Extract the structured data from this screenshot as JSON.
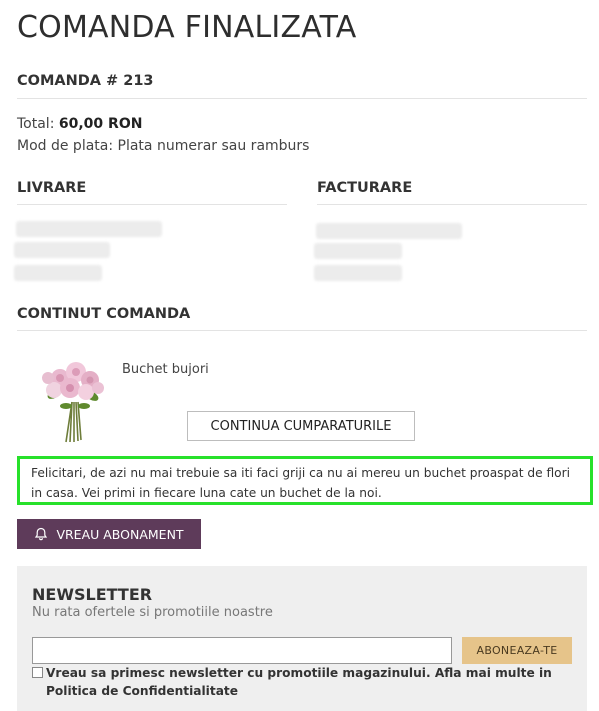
{
  "page_title": "COMANDA FINALIZATA",
  "order": {
    "heading": "COMANDA # 213",
    "total_label": "Total:",
    "total_value": "60,00 RON",
    "payment_line": "Mod de plata: Plata numerar sau ramburs"
  },
  "delivery": {
    "heading": "LIVRARE"
  },
  "billing": {
    "heading": "FACTURARE"
  },
  "contents": {
    "heading": "CONTINUT COMANDA",
    "product_name": "Buchet bujori",
    "continue_button": "CONTINUA CUMPARATURILE"
  },
  "notice": {
    "text": "Felicitari, de azi nu mai trebuie sa iti faci griji ca nu ai mereu un buchet proaspat de flori in casa. Vei primi in fiecare luna cate un buchet de la noi."
  },
  "subscription_button": "VREAU ABONAMENT",
  "newsletter": {
    "title": "NEWSLETTER",
    "subtitle": "Nu rata ofertele si promotiile noastre",
    "button": "ABONEAZA-TE",
    "consent_text": "Vreau sa primesc newsletter cu promotiile magazinului. Afla mai multe in ",
    "consent_link": "Politica de Confidentialitate"
  },
  "colors": {
    "accent_purple": "#5e3b5a",
    "newsletter_button": "#e6c48a",
    "highlight_border": "#27e12a"
  },
  "icons": {
    "subscription": "bell-icon",
    "product": "flower-bouquet-image"
  }
}
